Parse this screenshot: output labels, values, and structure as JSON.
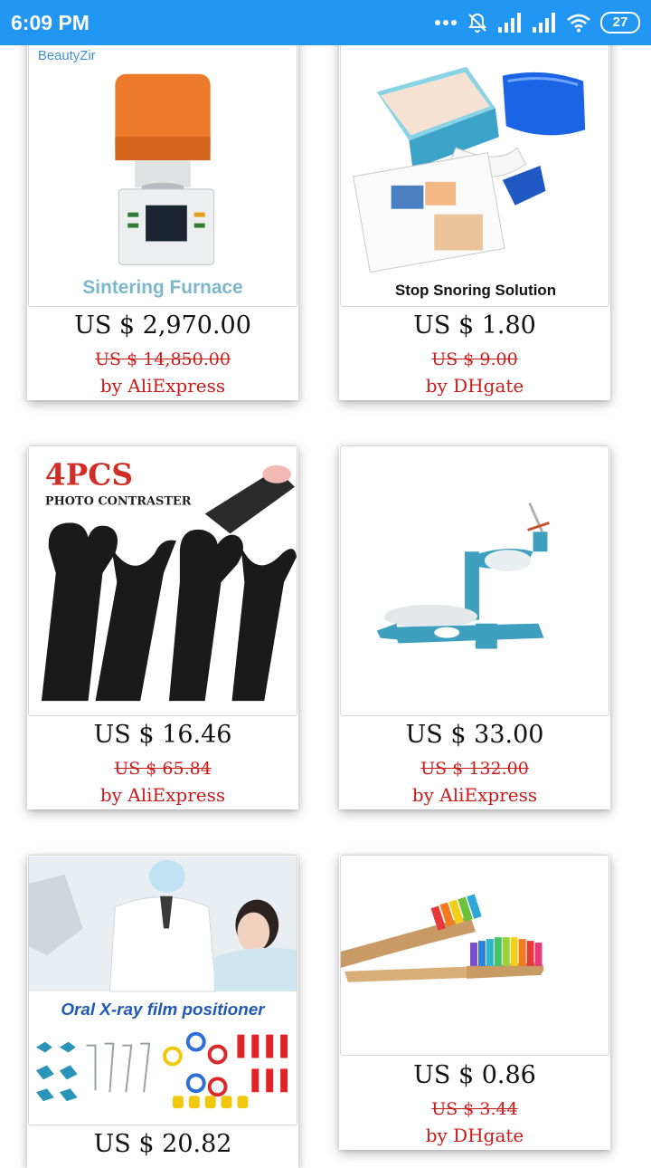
{
  "status_bar": {
    "time": "6:09 PM",
    "battery": "27",
    "icons": [
      "more-dots-icon",
      "alarm-off-icon",
      "signal-icon",
      "signal-icon",
      "wifi-icon",
      "battery-icon"
    ]
  },
  "products": [
    {
      "image_caption": "Sintering Furnace",
      "image_brand": "BeautyZir",
      "price": "US $ 2,970.00",
      "old_price": "US $ 14,850.00",
      "seller": "by AliExpress"
    },
    {
      "image_caption": "Stop Snoring Solution",
      "price": "US $ 1.80",
      "old_price": "US $ 9.00",
      "seller": "by DHgate"
    },
    {
      "image_caption": "4PCS",
      "image_subcaption": "PHOTO CONTRASTER",
      "price": "US $ 16.46",
      "old_price": "US $ 65.84",
      "seller": "by AliExpress"
    },
    {
      "price": "US $ 33.00",
      "old_price": "US $ 132.00",
      "seller": "by AliExpress"
    },
    {
      "image_caption": "Oral X-ray film positioner",
      "price": "US $ 20.82"
    },
    {
      "price": "US $ 0.86",
      "old_price": "US $ 3.44",
      "seller": "by DHgate"
    }
  ]
}
